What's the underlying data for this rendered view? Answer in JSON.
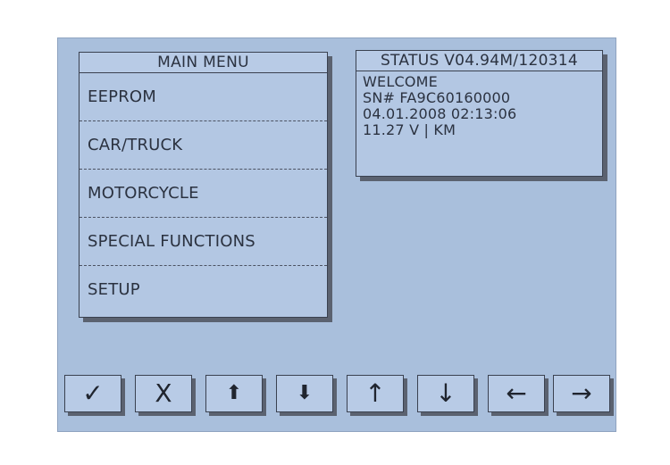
{
  "main_menu": {
    "title": "MAIN MENU",
    "items": [
      {
        "label": "EEPROM"
      },
      {
        "label": "CAR/TRUCK"
      },
      {
        "label": "MOTORCYCLE"
      },
      {
        "label": "SPECIAL FUNCTIONS"
      },
      {
        "label": "SETUP"
      }
    ]
  },
  "status": {
    "title": "STATUS V04.94M/120314",
    "lines": [
      "WELCOME",
      "SN# FA9C60160000",
      "04.01.2008  02:13:06",
      "11.27 V | KM"
    ]
  },
  "buttons": [
    {
      "name": "ok-check-icon",
      "glyph": "✓"
    },
    {
      "name": "cancel-x-icon",
      "glyph": "X"
    },
    {
      "name": "page-up-bold-icon",
      "glyph": "⬆"
    },
    {
      "name": "page-down-bold-icon",
      "glyph": "⬇"
    },
    {
      "name": "arrow-up-icon",
      "glyph": "↑"
    },
    {
      "name": "arrow-down-icon",
      "glyph": "↓"
    },
    {
      "name": "arrow-left-icon",
      "glyph": "←"
    },
    {
      "name": "arrow-right-icon",
      "glyph": "→"
    }
  ],
  "colors": {
    "screen_bg": "#a9bfdc",
    "text": "#2b3240",
    "shadow": "#5b6270"
  }
}
